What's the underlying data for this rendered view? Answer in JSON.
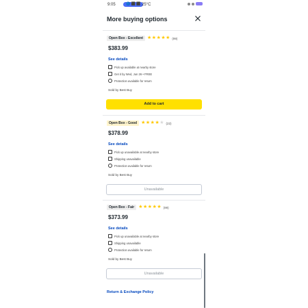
{
  "status_bar": {
    "time": "9:05",
    "pill_text": "🔵 ⬛ ⬛",
    "extra": "25°C"
  },
  "header": {
    "title": "More buying options",
    "close_icon": "close-icon"
  },
  "offers": [
    {
      "condition": "Open Box - Excellent",
      "badge_color": "#eeeeee",
      "rating": 5,
      "review_count": "(99)",
      "price": "$383.99",
      "see_details": "See details",
      "features": [
        {
          "icon": "store-icon",
          "text": "Pick up available at nearby store"
        },
        {
          "icon": "truck-icon",
          "text": "Get it by Wed, Jun 26 • FREE"
        },
        {
          "icon": "return-icon",
          "text": "Protection available for return"
        }
      ],
      "sold_by": "Sold by Best Buy",
      "action": {
        "label": "Add to cart",
        "available": true
      }
    },
    {
      "condition": "Open Box - Good",
      "badge_color": "#fff4cc",
      "rating": 4,
      "review_count": "(22)",
      "price": "$378.99",
      "see_details": "See details",
      "features": [
        {
          "icon": "store-icon",
          "text": "Pick up unavailable at nearby store"
        },
        {
          "icon": "truck-icon",
          "text": "Shipping unavailable"
        },
        {
          "icon": "return-icon",
          "text": "Protection available for return"
        }
      ],
      "sold_by": "Sold by Best Buy",
      "action": {
        "label": "Unavailable",
        "available": false
      }
    },
    {
      "condition": "Open Box - Fair",
      "badge_color": "#eeeeee",
      "rating": 5,
      "review_count": "(99)",
      "price": "$373.99",
      "see_details": "See details",
      "features": [
        {
          "icon": "store-icon",
          "text": "Pick up unavailable at nearby store"
        },
        {
          "icon": "truck-icon",
          "text": "Shipping unavailable"
        },
        {
          "icon": "return-icon",
          "text": "Protection available for return"
        }
      ],
      "sold_by": "Sold by Best Buy",
      "action": {
        "label": "Unavailable",
        "available": false
      }
    }
  ],
  "footer": {
    "return_policy": "Return & Exchange Policy"
  },
  "colors": {
    "accent_yellow": "#ffe000",
    "link_blue": "#0046be",
    "star": "#ffc800"
  }
}
